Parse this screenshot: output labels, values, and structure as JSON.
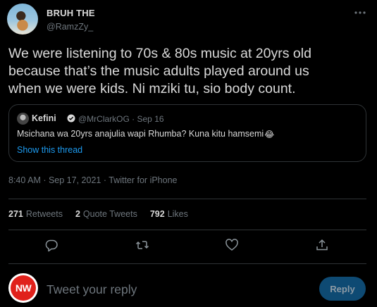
{
  "author": {
    "display_name": "BRUH THE",
    "handle": "@RamzZy_"
  },
  "tweet": {
    "text_lines": [
      "We were listening to 70s & 80s music at 20yrs old",
      "because that’s the music adults played around us",
      "when we were kids. Ni mziki tu, sio body count."
    ],
    "timestamp": "8:40 AM · Sep 17, 2021 · Twitter for iPhone"
  },
  "quote": {
    "name": "Kefini",
    "meta": "@MrClarkOG · Sep 16",
    "text": "Msichana wa 20yrs anajulia wapi Rhumba? Kuna kitu hamsemi",
    "emoji": "😂",
    "show_thread": "Show this thread"
  },
  "stats": {
    "retweets_count": "271",
    "retweets_label": "Retweets",
    "quotes_count": "2",
    "quotes_label": "Quote Tweets",
    "likes_count": "792",
    "likes_label": "Likes"
  },
  "actions": {
    "icons": [
      "reply-icon",
      "retweet-icon",
      "like-icon",
      "share-icon"
    ]
  },
  "composer": {
    "avatar_text": "NW",
    "placeholder": "Tweet your reply",
    "button_label": "Reply"
  },
  "colors": {
    "background": "#000000",
    "text": "#d9d9d9",
    "muted": "#6e767d",
    "accent": "#1d9bf0",
    "border": "#2f3336",
    "reply_button_disabled": "#0e4a73",
    "avatar_red": "#e0211b"
  }
}
